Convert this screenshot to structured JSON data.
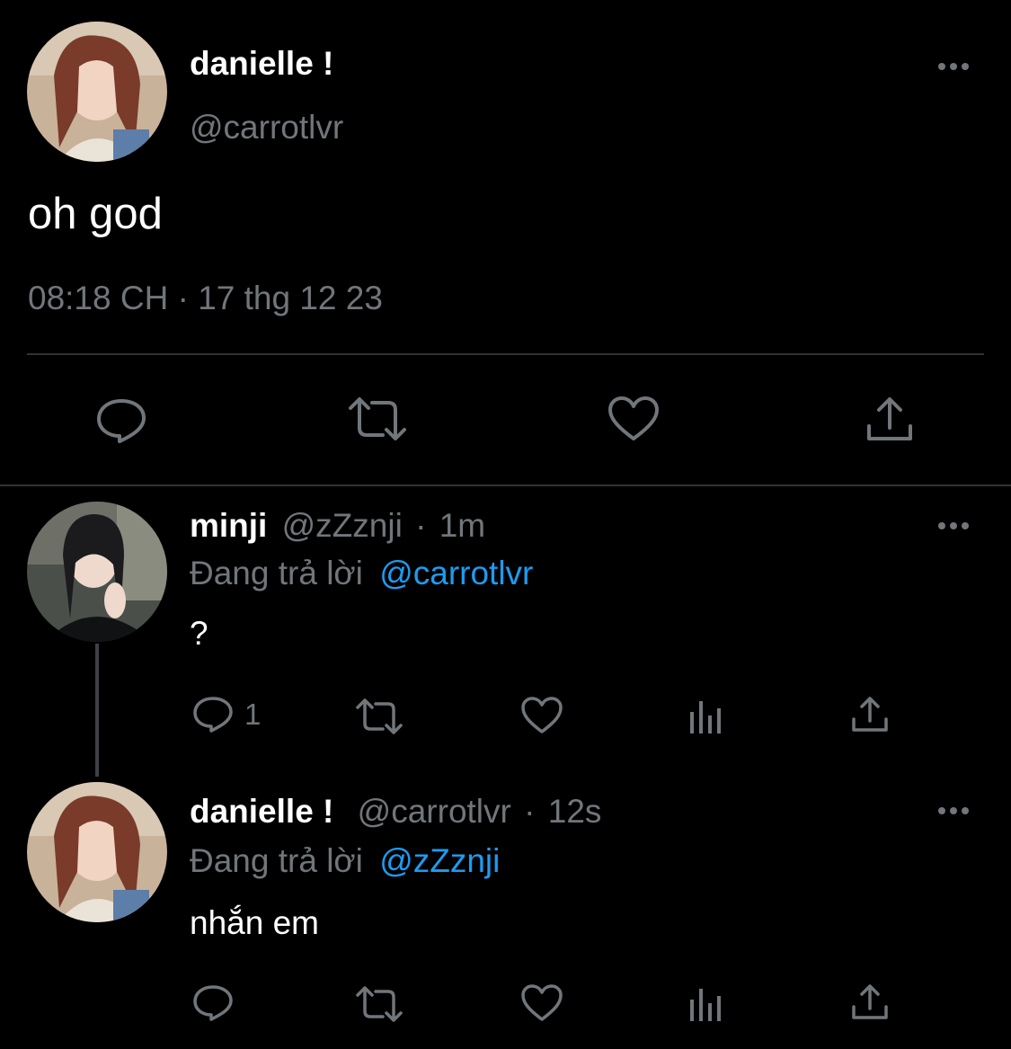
{
  "main_tweet": {
    "display_name": "danielle !",
    "handle": "@carrotlvr",
    "text": "oh god",
    "timestamp": "08:18 CH · 17 thg 12 23"
  },
  "replies": [
    {
      "display_name": "minji",
      "handle": "@zZznji",
      "separator": "·",
      "time_ago": "1m",
      "replying_to_label": "Đang trả lời",
      "replying_to_handle": "@carrotlvr",
      "text": "?",
      "reply_count": "1"
    },
    {
      "display_name": "danielle !",
      "handle": "@carrotlvr",
      "separator": "·",
      "time_ago": "12s",
      "replying_to_label": "Đang trả lời",
      "replying_to_handle": "@zZznji",
      "text": "nhắn em",
      "reply_count": ""
    }
  ],
  "icons": {
    "more": "more-horizontal-icon",
    "reply": "reply-icon",
    "retweet": "retweet-icon",
    "like": "heart-icon",
    "views": "bar-chart-icon",
    "share": "share-icon"
  },
  "colors": {
    "background": "#000000",
    "primary_text": "#ffffff",
    "secondary_text": "#71767b",
    "link": "#1d9bf0",
    "divider": "#2f3336"
  }
}
